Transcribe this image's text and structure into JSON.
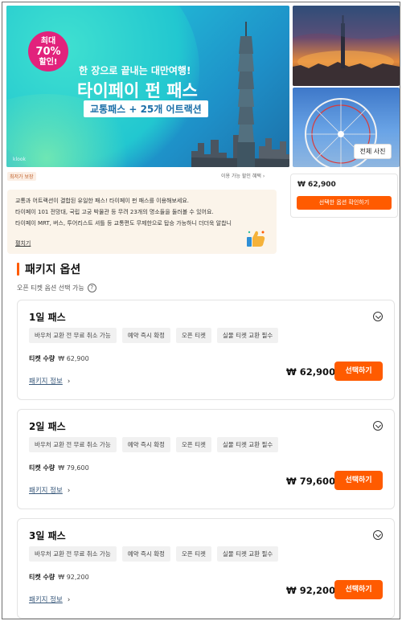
{
  "hero": {
    "badge_line1": "최대",
    "badge_line2": "70%",
    "badge_line3": "할인!",
    "subtitle": "한 장으로 끝내는 대만여행!",
    "title": "타이페이 펀 패스",
    "tag": "교통패스 + 25개 어트랙션",
    "brand_mark": "klook",
    "view_all_label": "전체 사진"
  },
  "info": {
    "left_tag": "최저가 보장",
    "right_link": "이용 가능 할인 혜택",
    "description_lines": [
      "교통과 어트랙션이 결합된 유일한 패스! 타이페이 펀 패스를 이용해보세요.",
      "타이페이 101 전망대, 국립 고궁 박물관 등 무려 23개의 명소들을 둘러볼 수 있어요.",
      "타이페이 MRT, 버스, 투어리스트 셔틀 등 교통편도 무제한으로 탑승 가능하니 더더욱 알찹니"
    ],
    "more_label": "펼치기"
  },
  "price_box": {
    "price": "₩ 62,900",
    "cta": "선택한 옵션 확인하기"
  },
  "section": {
    "title": "패키지 옵션",
    "subtitle": "오픈 티켓 옵션 선택 가능",
    "help_glyph": "?"
  },
  "packages": [
    {
      "name": "1일 패스",
      "chips": [
        "바우처 교환 전 무료 취소 가능",
        "예약 즉시 확정",
        "오픈 티켓",
        "실물 티켓 교환 필수"
      ],
      "qty_label": "티켓 수량",
      "qty_value": "₩ 62,900",
      "info_label": "패키지 정보",
      "price": "₩ 62,900",
      "book_label": "선택하기"
    },
    {
      "name": "2일 패스",
      "chips": [
        "바우처 교환 전 무료 취소 가능",
        "예약 즉시 확정",
        "오픈 티켓",
        "실물 티켓 교환 필수"
      ],
      "qty_label": "티켓 수량",
      "qty_value": "₩ 79,600",
      "info_label": "패키지 정보",
      "price": "₩ 79,600",
      "book_label": "선택하기"
    },
    {
      "name": "3일 패스",
      "chips": [
        "바우처 교환 전 무료 취소 가능",
        "예약 즉시 확정",
        "오픈 티켓",
        "실물 티켓 교환 필수"
      ],
      "qty_label": "티켓 수량",
      "qty_value": "₩ 92,200",
      "info_label": "패키지 정보",
      "price": "₩ 92,200",
      "book_label": "선택하기"
    }
  ],
  "colors": {
    "accent": "#ff5b00",
    "badge": "#e2227c",
    "hero_bg": "#21b7d6"
  },
  "icons": {
    "help": "help-circle-icon",
    "toggle": "chevron-down-circle-icon",
    "info_chevron": "chevron-right-icon",
    "thumb": "thumbs-up-icon"
  }
}
